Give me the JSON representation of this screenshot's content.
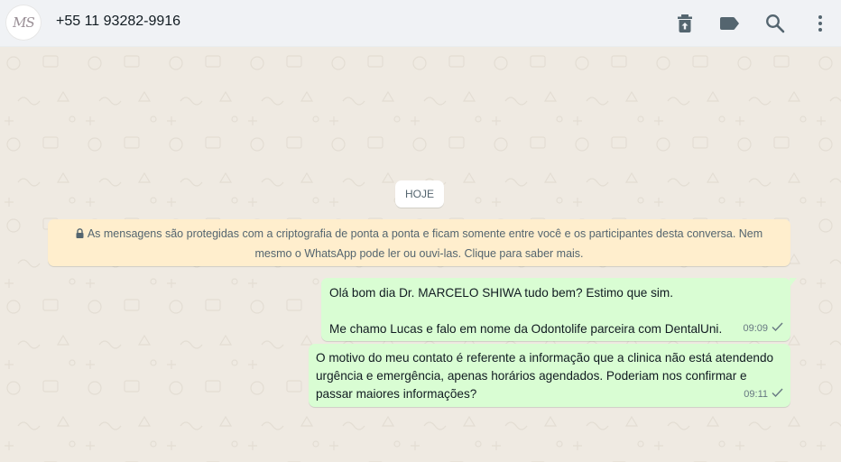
{
  "header": {
    "avatar_text": "MS",
    "contact": "+55 11 93282-9916",
    "icons": [
      "delete-icon",
      "label-icon",
      "search-icon",
      "menu-icon"
    ]
  },
  "chat": {
    "date_chip": "HOJE",
    "encryption_notice": "As mensagens são protegidas com a criptografia de ponta a ponta e ficam somente entre você e os participantes desta conversa. Nem mesmo o WhatsApp pode ler ou ouvi-las. Clique para saber mais.",
    "messages": [
      {
        "text": "Olá bom dia Dr. MARCELO SHIWA tudo bem? Estimo que sim.\n\nMe chamo Lucas e falo em nome da Odontolife parceira com DentalUni.",
        "time": "09:09",
        "status": "sent-check"
      },
      {
        "text": "O motivo do meu contato é referente a informação que a clinica não está atendendo urgência e emergência, apenas horários agendados. Poderiam nos confirmar e passar maiores informações?",
        "time": "09:11",
        "status": "sent-check"
      }
    ]
  },
  "colors": {
    "header_bg": "#f0f2f5",
    "chat_bg": "#efeae2",
    "outgoing_bubble": "#d9fdd3",
    "notice_bg": "#ffeecd",
    "icon": "#54656f"
  }
}
